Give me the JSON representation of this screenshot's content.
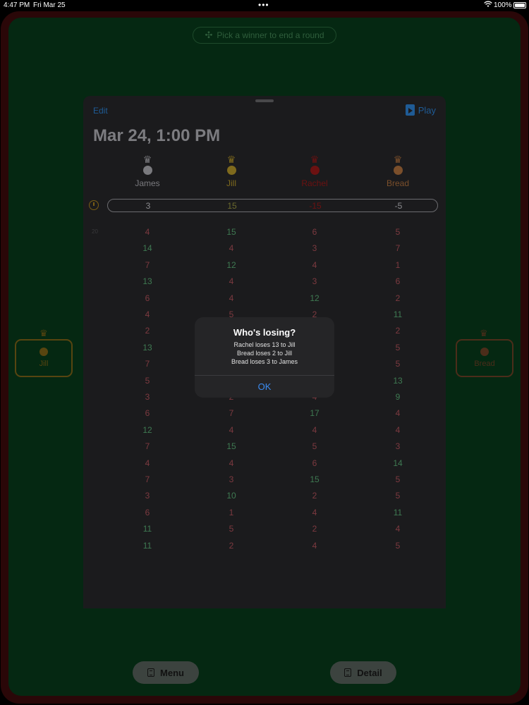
{
  "status_bar": {
    "time": "4:47 PM",
    "date": "Fri Mar 25",
    "battery": "100%"
  },
  "hint": {
    "label": "Pick a winner to end a round"
  },
  "seats": {
    "left": {
      "name": "Jill"
    },
    "right": {
      "name": "Bread"
    }
  },
  "sheet": {
    "edit_label": "Edit",
    "play_label": "Play",
    "title": "Mar 24, 1:00 PM",
    "players": [
      {
        "name": "James",
        "total": "3",
        "color": "#7a7a7e",
        "crown": "#7a7a7e"
      },
      {
        "name": "Jill",
        "total": "15",
        "color": "#7f6a1d",
        "crown": "#7f6a1d"
      },
      {
        "name": "Rachel",
        "total": "-15",
        "color": "#6c1111",
        "crown": "#6c1111"
      },
      {
        "name": "Bread",
        "total": "-5",
        "color": "#7b4f2b",
        "crown": "#7b4f2b"
      }
    ],
    "first_round_label": "20",
    "rounds": [
      [
        "4",
        "15",
        "6",
        "5"
      ],
      [
        "14",
        "4",
        "3",
        "7"
      ],
      [
        "7",
        "12",
        "4",
        "1"
      ],
      [
        "13",
        "4",
        "3",
        "6"
      ],
      [
        "6",
        "4",
        "12",
        "2"
      ],
      [
        "4",
        "5",
        "2",
        "11"
      ],
      [
        "2",
        "",
        "",
        "2"
      ],
      [
        "13",
        "",
        "",
        "5"
      ],
      [
        "7",
        "",
        "",
        "5"
      ],
      [
        "5",
        "",
        "",
        "13"
      ],
      [
        "3",
        "2",
        "4",
        "9"
      ],
      [
        "6",
        "7",
        "17",
        "4"
      ],
      [
        "12",
        "4",
        "4",
        "4"
      ],
      [
        "7",
        "15",
        "5",
        "3"
      ],
      [
        "4",
        "4",
        "6",
        "14"
      ],
      [
        "7",
        "3",
        "15",
        "5"
      ],
      [
        "3",
        "10",
        "2",
        "5"
      ],
      [
        "6",
        "1",
        "4",
        "11"
      ],
      [
        "11",
        "5",
        "2",
        "4"
      ],
      [
        "11",
        "2",
        "4",
        "5"
      ]
    ]
  },
  "alert": {
    "title": "Who's losing?",
    "lines": [
      "Rachel loses 13 to Jill",
      "Bread loses 2 to Jill",
      "Bread loses 3 to James"
    ],
    "ok_label": "OK"
  },
  "bottom": {
    "menu_label": "Menu",
    "detail_label": "Detail"
  },
  "colors": {
    "high": "#3f7a52",
    "low": "#7d3a40",
    "felt": "#052812",
    "accent": "#1f5b95"
  }
}
